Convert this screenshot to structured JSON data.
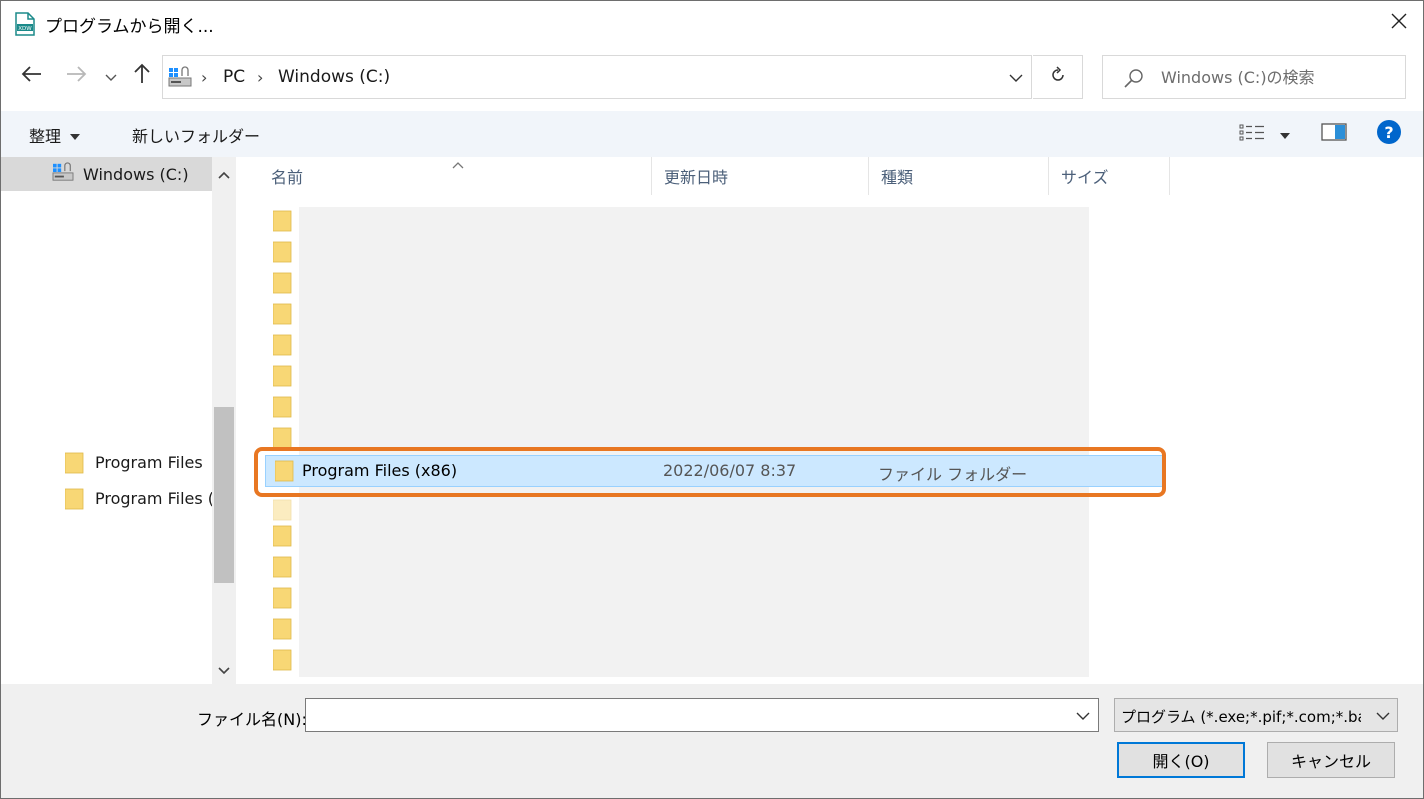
{
  "window": {
    "title": "プログラムから開く..."
  },
  "icons": {
    "app": "xdw-document-icon",
    "close": "close-icon",
    "back": "arrow-left-icon",
    "forward": "arrow-right-icon",
    "recent": "chevron-down-icon",
    "up": "arrow-up-icon",
    "refresh": "refresh-icon",
    "search": "search-icon",
    "view": "details-view-icon",
    "preview": "preview-pane-icon",
    "help": "help-icon"
  },
  "address": {
    "crumbs": [
      "PC",
      "Windows (C:)"
    ]
  },
  "search": {
    "placeholder": "Windows (C:)の検索"
  },
  "toolbar": {
    "organize": "整理",
    "new_folder": "新しいフォルダー"
  },
  "nav_tree": {
    "drive": "Windows (C:)",
    "items": [
      "Program Files",
      "Program Files ("
    ]
  },
  "columns": [
    "名前",
    "更新日時",
    "種類",
    "サイズ"
  ],
  "selected_file": {
    "name": "Program Files (x86)",
    "date": "2022/06/07 8:37",
    "type": "ファイル フォルダー"
  },
  "bottom": {
    "filename_label": "ファイル名(N):",
    "filename_value": "",
    "filter": "プログラム (*.exe;*.pif;*.com;*.bat",
    "open_button": "開く(O)",
    "cancel_button": "キャンセル"
  },
  "colors": {
    "accent": "#0078d7",
    "selection": "#cce8ff",
    "highlight": "#e87722",
    "folder": "#f8d775"
  }
}
